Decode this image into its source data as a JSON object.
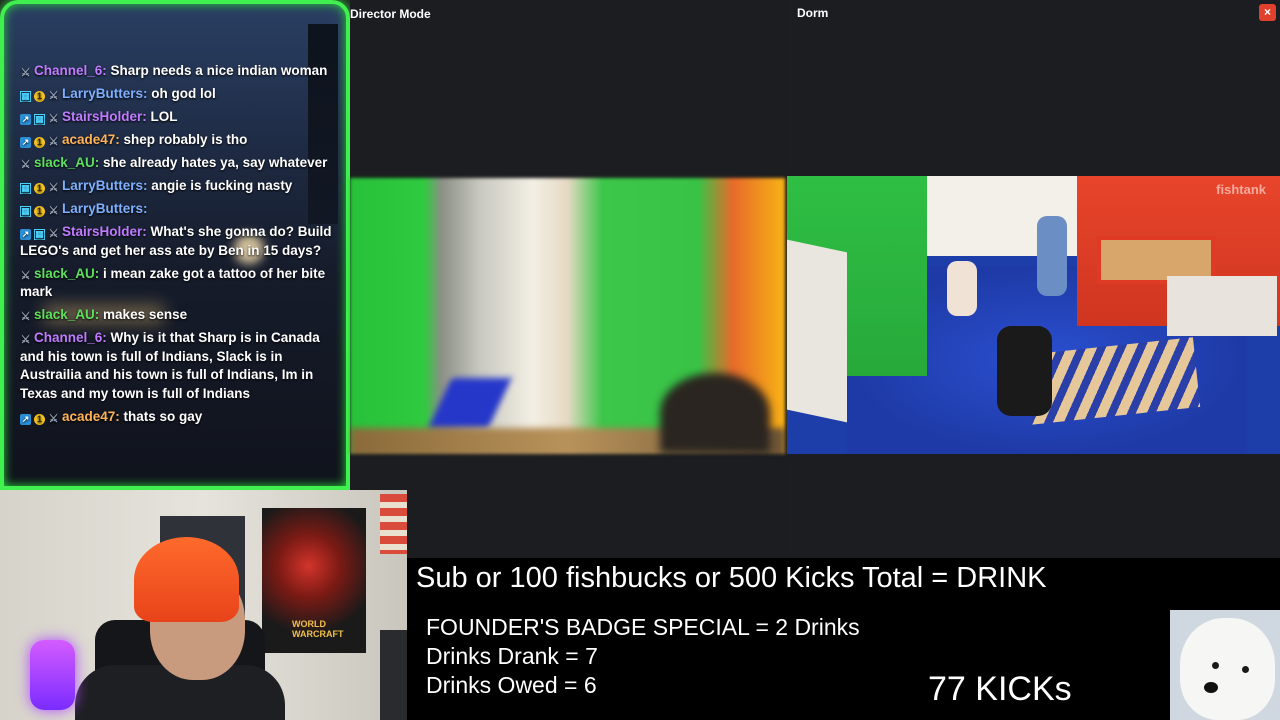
{
  "panes": {
    "director_title": "Director Mode",
    "dorm_title": "Dorm",
    "dorm_watermark": "fishtank",
    "close_glyph": "×"
  },
  "chat": {
    "messages": [
      {
        "user": "Channel_6",
        "color": "u-purple",
        "badges": [
          "kick"
        ],
        "text": "Sharp needs a nice indian woman"
      },
      {
        "user": "LarryButters",
        "color": "u-blue",
        "badges": [
          "grid",
          "coin",
          "kick"
        ],
        "text": "oh god lol"
      },
      {
        "user": "StairsHolder",
        "color": "u-purple",
        "badges": [
          "sub",
          "grid",
          "kick"
        ],
        "text": "LOL"
      },
      {
        "user": "acade47",
        "color": "u-orange",
        "badges": [
          "sub",
          "coin",
          "kick"
        ],
        "text": "shep robably is tho"
      },
      {
        "user": "slack_AU",
        "color": "u-green",
        "badges": [
          "kick"
        ],
        "text": "she already hates ya, say whatever"
      },
      {
        "user": "LarryButters",
        "color": "u-blue",
        "badges": [
          "grid",
          "coin",
          "kick"
        ],
        "text": "angie is fucking nasty"
      },
      {
        "user": "LarryButters",
        "color": "u-blue",
        "badges": [
          "grid",
          "coin",
          "kick"
        ],
        "text": ""
      },
      {
        "user": "StairsHolder",
        "color": "u-purple",
        "badges": [
          "sub",
          "grid",
          "kick"
        ],
        "text": "What's she gonna do? Build LEGO's and get her ass ate by Ben in 15 days?"
      },
      {
        "user": "slack_AU",
        "color": "u-green",
        "badges": [
          "kick"
        ],
        "text": "i mean zake got a tattoo of her bite mark"
      },
      {
        "user": "slack_AU",
        "color": "u-green",
        "badges": [
          "kick"
        ],
        "text": "makes sense"
      },
      {
        "user": "Channel_6",
        "color": "u-purple",
        "badges": [
          "kick"
        ],
        "text": "Why is it that Sharp is in Canada and his town is full of Indians, Slack is in Austrailia and his town is full of Indians, Im in Texas and my town is full of Indians"
      },
      {
        "user": "acade47",
        "color": "u-orange",
        "badges": [
          "sub",
          "coin",
          "kick"
        ],
        "text": "thats so gay"
      }
    ]
  },
  "webcam": {
    "poster_text": "WORLD WARCRAFT"
  },
  "overlay": {
    "main": "Sub or 100 fishbucks or 500 Kicks Total = DRINK",
    "founder": "FOUNDER'S BADGE SPECIAL = 2 Drinks",
    "drank": "Drinks Drank = 7",
    "owed": "Drinks Owed = 6",
    "kicks": "77 KICKs"
  },
  "icons": {
    "badge_sub": "arrow-badge-icon",
    "badge_grid": "grid-badge-icon",
    "badge_coin": "coin-badge-icon",
    "badge_kick": "kick-badge-icon"
  },
  "colors": {
    "chat_border": "#3ff04e",
    "close": "#e0402c"
  }
}
